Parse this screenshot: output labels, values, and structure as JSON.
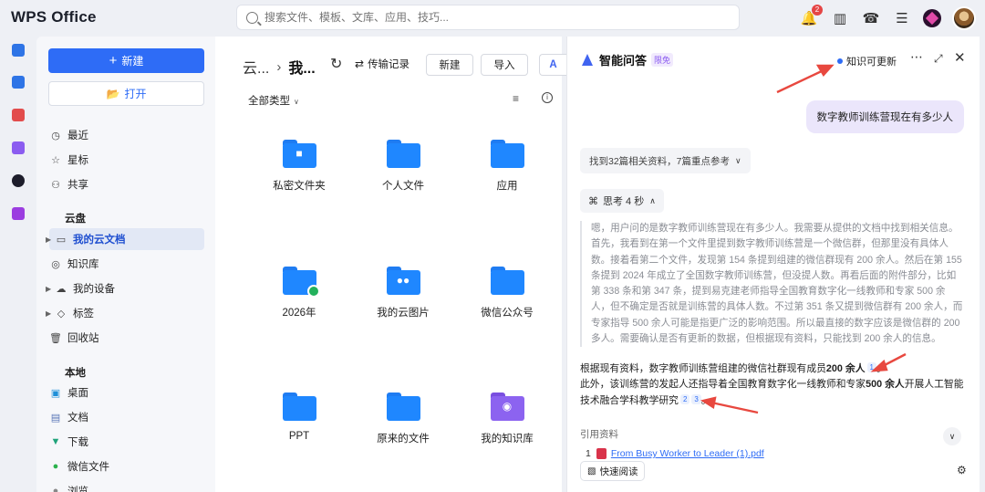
{
  "app": {
    "title": "WPS Office"
  },
  "search": {
    "placeholder": "搜索文件、模板、文库、应用、技巧..."
  },
  "topbar": {
    "notification_count": "2"
  },
  "nav": {
    "new_label": "新建",
    "open_label": "打开",
    "items_top": [
      {
        "label": "最近",
        "icon": "clock-icon"
      },
      {
        "label": "星标",
        "icon": "star-icon"
      },
      {
        "label": "共享",
        "icon": "share-icon"
      }
    ],
    "cloud_section": "云盘",
    "cloud_items": [
      {
        "label": "我的云文档",
        "icon": "folder-icon",
        "active": true
      },
      {
        "label": "知识库",
        "icon": "knowledge-icon"
      },
      {
        "label": "我的设备",
        "icon": "device-cloud-icon"
      },
      {
        "label": "标签",
        "icon": "tag-icon"
      },
      {
        "label": "回收站",
        "icon": "trash-icon"
      }
    ],
    "local_section": "本地",
    "local_items": [
      {
        "label": "桌面",
        "icon": "desktop-icon"
      },
      {
        "label": "文档",
        "icon": "documents-icon"
      },
      {
        "label": "下载",
        "icon": "download-icon"
      },
      {
        "label": "微信文件",
        "icon": "wechat-icon"
      },
      {
        "label": "浏览",
        "icon": "browse-icon"
      }
    ]
  },
  "files": {
    "breadcrumb_root": "云...",
    "breadcrumb_current": "我...",
    "transfer_label": "传输记录",
    "new_button": "新建",
    "import_button": "导入",
    "filter_label": "全部类型",
    "tiles": [
      {
        "label": "私密文件夹",
        "kind": "lock"
      },
      {
        "label": "个人文件",
        "kind": "plain"
      },
      {
        "label": "应用",
        "kind": "plain"
      },
      {
        "label": "2026年",
        "kind": "cloud"
      },
      {
        "label": "我的云图片",
        "kind": "people"
      },
      {
        "label": "微信公众号",
        "kind": "plain"
      },
      {
        "label": "PPT",
        "kind": "plain"
      },
      {
        "label": "原来的文件",
        "kind": "plain"
      },
      {
        "label": "我的知识库",
        "kind": "bulb"
      }
    ]
  },
  "ai": {
    "title": "智能问答",
    "tag": "限免",
    "kb_update": "知识可更新",
    "user_question": "数字教师训练营现在有多少人",
    "found_summary": "找到32篇相关资料，7篇重点参考",
    "think_label": "思考 4 秒",
    "thought": "嗯，用户问的是数字教师训练营现在有多少人。我需要从提供的文档中找到相关信息。首先，我看到在第一个文件里提到数字教师训练营是一个微信群，但那里没有具体人数。接着看第二个文件，发现第 154 条提到组建的微信群现有 200 余人。然后在第 155 条提到 2024 年成立了全国数字教师训练营，但没提人数。再看后面的附件部分，比如第 338 条和第 347 条，提到易克建老师指导全国教育数字化一线教师和专家 500 余人，但不确定是否就是训练营的具体人数。不过第 351 条又提到微信群有 200 余人，而专家指导 500 余人可能是指更广泛的影响范围。所以最直接的数字应该是微信群的 200 多人。需要确认是否有更新的数据，但根据现有资料，只能找到 200 余人的信息。",
    "answer_line1_pre": "根据现有资料，数字教师训练营组建的微信社群现有成员",
    "answer_line1_bold": "200 余人",
    "answer_line1_cite": "1",
    "answer_line2_pre": "此外，该训练营的发起人还指导着全国教育数字化一线教师和专家",
    "answer_line2_bold": "500 余人",
    "answer_line2_post": "开展人工智能技术融合学科教学研究",
    "answer_line2_cite_a": "2",
    "answer_line2_cite_b": "3",
    "refs_label": "引用资料",
    "ref_1_num": "1",
    "ref_1_title": "From Busy Worker to Leader (1).pdf",
    "quick_read": "快速阅读"
  },
  "colors": {
    "accent": "#2e6cf6",
    "folder_blue": "#1f87ff",
    "folder_purple": "#8c63f0",
    "annotation_red": "#e8483f"
  }
}
